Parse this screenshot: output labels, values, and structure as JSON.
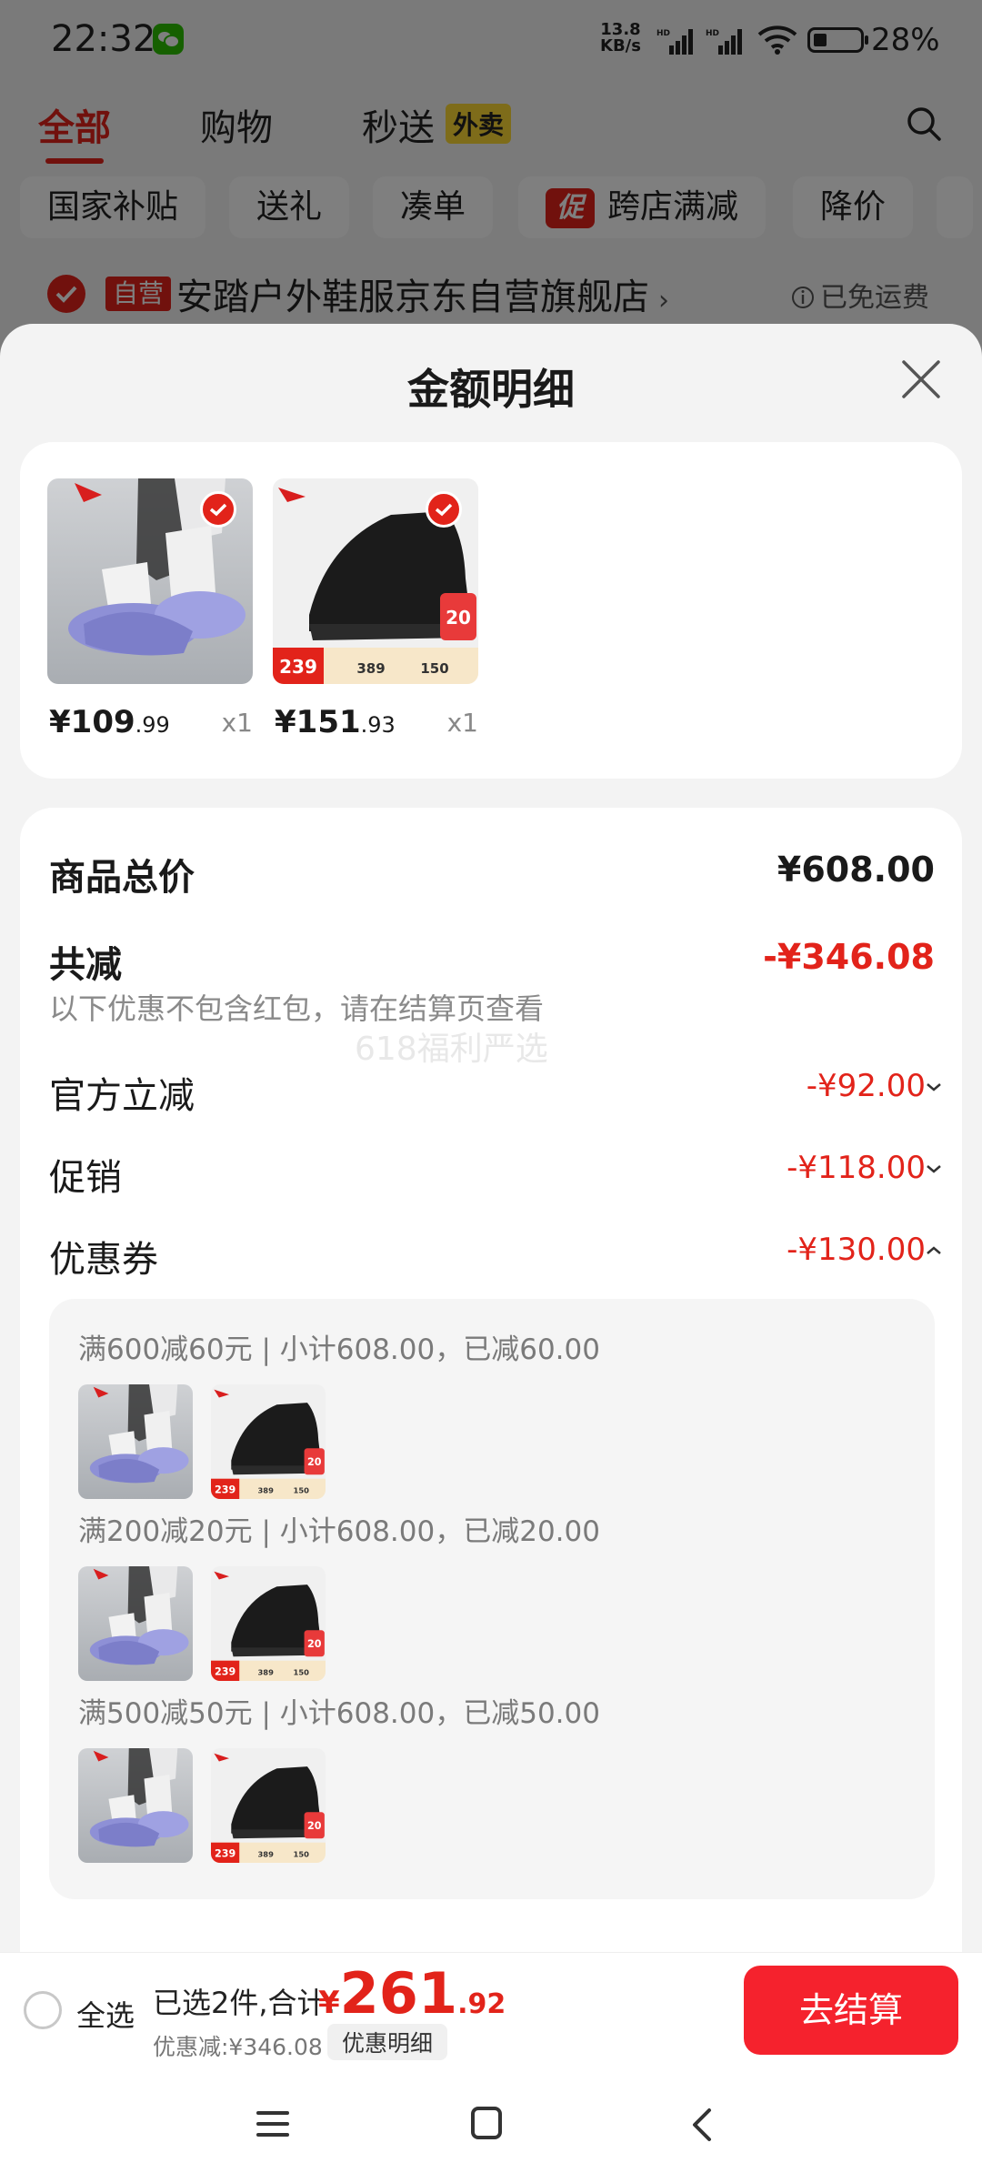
{
  "status_bar": {
    "time": "22:32",
    "net_speed_value": "13.8",
    "net_speed_unit": "KB/s",
    "signal_label": "HD",
    "battery": "28%"
  },
  "nav": {
    "tabs": [
      "全部",
      "购物",
      "秒送"
    ],
    "waimai_badge": "外卖"
  },
  "chips": {
    "items": [
      "国家补贴",
      "送礼",
      "凑单",
      "跨店满减",
      "降价"
    ],
    "promo_mark": "促"
  },
  "shop": {
    "badge": "自营",
    "name": "安踏户外鞋服京东自营旗舰店",
    "arrow": "›",
    "fee": "已免运费"
  },
  "sheet": {
    "title": "金额明细",
    "products": [
      {
        "price_int": "¥109",
        "price_dec": ".99",
        "qty": "x1"
      },
      {
        "price_int": "¥151",
        "price_dec": ".93",
        "qty": "x1"
      }
    ],
    "shoe_tag": {
      "price": "239",
      "p1": "389",
      "p2": "150",
      "badge": "20"
    },
    "summary": {
      "total_label": "商品总价",
      "total_value": "¥608.00",
      "reduce_label": "共减",
      "reduce_value": "-¥346.08",
      "note": "以下优惠不包含红包，请在结算页查看",
      "watermark": "618福利严选",
      "rows": [
        {
          "label": "官方立减",
          "value": "-¥92.00"
        },
        {
          "label": "促销",
          "value": "-¥118.00"
        },
        {
          "label": "优惠券",
          "value": "-¥130.00"
        }
      ]
    },
    "coupons": [
      {
        "text": "满600减60元 | 小计608.00，已减60.00"
      },
      {
        "text": "满200减20元 | 小计608.00，已减20.00"
      },
      {
        "text": "满500减50元 | 小计608.00，已减50.00"
      }
    ]
  },
  "checkout": {
    "select_all": "全选",
    "selected": "已选2件,合计:",
    "yen": "¥",
    "total_int": "261",
    "total_dec": ".92",
    "discount": "优惠减:¥346.08",
    "detail_btn": "优惠明细",
    "button": "去结算"
  },
  "colors": {
    "accent": "#e2231a",
    "checkout_button": "#f5222d"
  }
}
